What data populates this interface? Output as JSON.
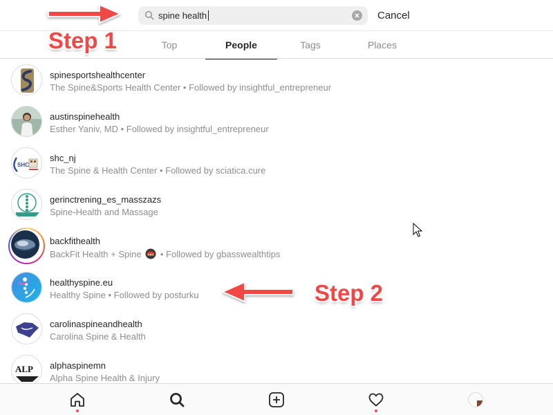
{
  "search": {
    "value": "spine health",
    "placeholder": "Search",
    "cancel_label": "Cancel"
  },
  "tabs": [
    {
      "label": "Top",
      "active": false
    },
    {
      "label": "People",
      "active": true
    },
    {
      "label": "Tags",
      "active": false
    },
    {
      "label": "Places",
      "active": false
    }
  ],
  "results": [
    {
      "username": "spinesportshealthcenter",
      "subtitle": "The Spine&Sports Health Center • Followed by insightful_entrepreneur"
    },
    {
      "username": "austinspinehealth",
      "subtitle": "Esther Yaniv, MD • Followed by insightful_entrepreneur"
    },
    {
      "username": "shc_nj",
      "subtitle": "The Spine & Health Center • Followed by sciatica.cure"
    },
    {
      "username": "gerinctrening_es_masszazs",
      "subtitle": "Spine-Health and Massage"
    },
    {
      "username": "backfithealth",
      "subtitle_pre": "BackFit Health + Spine",
      "subtitle_post": "• Followed by gbasswealthtips",
      "has_story": true
    },
    {
      "username": "healthyspine.eu",
      "subtitle": "Healthy Spine • Followed by posturku"
    },
    {
      "username": "carolinaspineandhealth",
      "subtitle": "Carolina Spine & Health"
    },
    {
      "username": "alphaspinemn",
      "subtitle": "Alpha Spine Health & Injury"
    }
  ],
  "annotations": {
    "step1": "Step 1",
    "step2": "Step 2"
  },
  "nav": [
    {
      "icon": "home-icon",
      "notification_dot": true
    },
    {
      "icon": "search-icon",
      "active": true
    },
    {
      "icon": "new-post-icon"
    },
    {
      "icon": "activity-heart-icon",
      "notification_dot": true
    },
    {
      "icon": "profile-avatar"
    }
  ],
  "colors": {
    "annotation_red": "#f04747",
    "notification_red": "#ed4956",
    "story_ring": "#d62976",
    "text_primary": "#262626",
    "text_secondary": "#8e8e8e"
  }
}
